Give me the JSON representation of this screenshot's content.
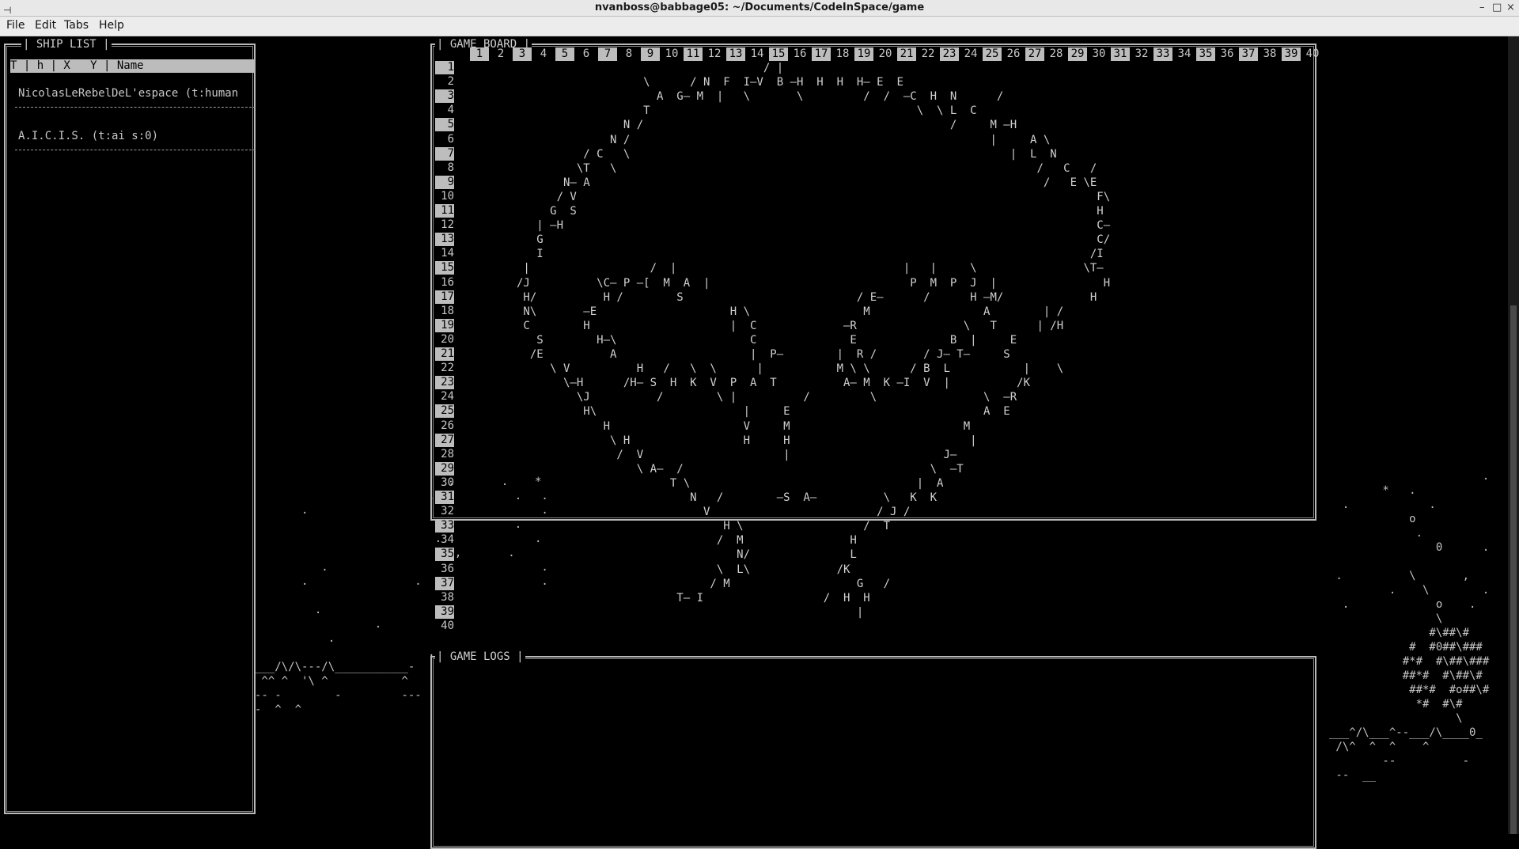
{
  "window": {
    "title": "nvanboss@babbage05: ~/Documents/CodeInSpace/game",
    "controls": [
      "–",
      "□",
      "×"
    ]
  },
  "menu": [
    "File",
    "Edit",
    "Tabs",
    "Help"
  ],
  "ship_list": {
    "title": "SHIP LIST",
    "header": "T | h | X   Y | Name",
    "ships": [
      "NicolasLeRebelDeL'espace (t:human",
      "A.I.C.I.S. (t:ai s:0)"
    ]
  },
  "game_board": {
    "title": "GAME BOARD",
    "columns": [
      1,
      2,
      3,
      4,
      5,
      6,
      7,
      8,
      9,
      10,
      11,
      12,
      13,
      14,
      15,
      16,
      17,
      18,
      19,
      20,
      21,
      22,
      23,
      24,
      25,
      26,
      27,
      28,
      29,
      30,
      31,
      32,
      33,
      34,
      35,
      36,
      37,
      38,
      39,
      40
    ],
    "rows": [
      1,
      2,
      3,
      4,
      5,
      6,
      7,
      8,
      9,
      10,
      11,
      12,
      13,
      14,
      15,
      16,
      17,
      18,
      19,
      20,
      21,
      22,
      23,
      24,
      25,
      26,
      27,
      28,
      29,
      30,
      31,
      32,
      33,
      34,
      35,
      36,
      37,
      38,
      39,
      40
    ],
    "lines": [
      "                                            / |",
      "                          \\      / N  F  I—V  B —H  H  H  H— E  E",
      "                            A  G— M  |   \\       \\         /  /  —C  H  N      /",
      "                          T                                        \\  \\ L  C",
      "                       N /                                              /     M —H",
      "                     N /                                                      |     A \\",
      "                 / C   \\                                                         |  L  N",
      "                \\T   \\                                                               /   C   /",
      "              N— A                                                                    /   E \\E",
      "             / V                                                                              F\\",
      "            G  S                                                                              H",
      "          | —H                                                                                C—",
      "          G                                                                                   C/",
      "          I                                                                                  /I",
      "        |                  /  |                                  |   |     \\                \\T—",
      "       /J          \\C— P —[  M  A  |                              P  M  P  J  |                H",
      "        H/          H /        S                          / E—      /      H —M/             H",
      "        N\\       —E                    H \\                 M                 A        | /",
      "        C        H                     |  C             —R                \\   T      | /H",
      "          S        H—\\                    C              E              B  |     E",
      "         /E          A                    |  P—        |  R /       / J— T—     S",
      "            \\ V          H   /   \\  \\      |           M \\ \\      / B  L           |    \\",
      "              \\—H      /H— S  H  K  V  P  A  T          A— M  K —I  V  |          /K",
      "                \\J          /        \\ |          /         \\                \\  —R",
      "                 H\\                      |     E                             A  E",
      "                    H                    V     M                          M",
      "                     \\ H                 H     H                           |",
      "                      /  V                     |                       J—",
      "                         \\ A—  /                                     \\  —T",
      "                              T \\                                  |  A",
      "                                 N   /        —S  A—          \\   K  K",
      "                                   V                         / J /",
      "                                      H \\                  /  T",
      "                                     /  M                H",
      "                                        N/               L",
      "                                     \\  L\\             /K",
      "                                    / M                   G   /",
      "                               T— I                  /  H  H",
      "                                                          |",
      ""
    ]
  },
  "game_logs": {
    "title": "GAME LOGS"
  },
  "left_art": [
    "                             .       .    *",
    "                          .            .   .",
    "       .                                   .",
    "                           .           .",
    "                           .              .",
    "                              ,       .",
    "          .                                .",
    "       .                .                  .",
    "",
    "         .",
    "                  .",
    "           .",
    "                          .",
    "___/\\/\\---/\\___________-",
    " ^^ ^  '\\ ^           ^",
    "-- -        -         ---",
    "-  ^  ^"
  ],
  "right_art": [
    "                       .",
    "        *   .",
    "  .            .",
    "            o",
    "             .",
    "                0      .   .",
    "                               .",
    " .          \\       ,",
    "         .    \\        .",
    "  .             o    .",
    "                \\",
    "               #\\##\\#",
    "            #  #0##\\###",
    "           #*#  #\\##\\###",
    "           ##*#  #\\##\\#",
    "            ##*#  #o##\\#",
    "             *#  #\\#",
    "                   \\",
    "___^/\\___^--___/\\____0_",
    " /\\^  ^  ^    ^",
    "        --          -",
    " --  __"
  ],
  "highlight_color": "#bdbdbd"
}
